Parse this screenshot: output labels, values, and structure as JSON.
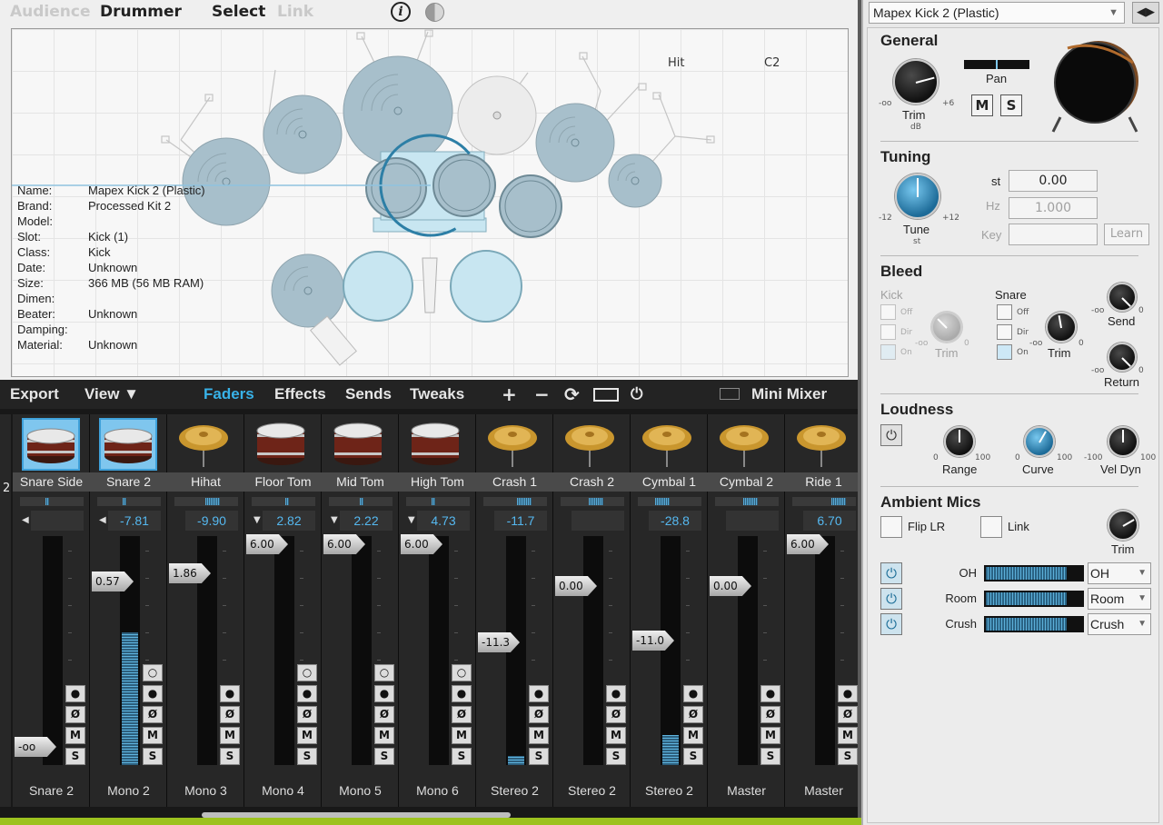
{
  "top_nav": {
    "audience": "Audience",
    "drummer": "Drummer",
    "select": "Select",
    "link": "Link"
  },
  "info_icon": "i",
  "hit_labels": {
    "hit": "Hit",
    "note": "C2"
  },
  "instrument_info": [
    {
      "k": "Name:",
      "v": "Mapex Kick 2 (Plastic)"
    },
    {
      "k": "Brand:",
      "v": "Processed Kit 2"
    },
    {
      "k": "Model:",
      "v": ""
    },
    {
      "k": "Slot:",
      "v": "Kick (1)"
    },
    {
      "k": "Class:",
      "v": "Kick"
    },
    {
      "k": "Date:",
      "v": "Unknown"
    },
    {
      "k": "Size:",
      "v": "366 MB (56 MB RAM)"
    },
    {
      "k": "Dimen:",
      "v": ""
    },
    {
      "k": "Beater:",
      "v": "Unknown"
    },
    {
      "k": "Damping:",
      "v": ""
    },
    {
      "k": "Material:",
      "v": "Unknown"
    }
  ],
  "toolbar": {
    "export": "Export",
    "view": "View ▼",
    "faders": "Faders",
    "effects": "Effects",
    "sends": "Sends",
    "tweaks": "Tweaks",
    "add": "+",
    "remove": "−",
    "refresh": "⟳",
    "power": "⏻",
    "mini_mixer": "Mini Mixer"
  },
  "left_edge": {
    "name": "2",
    "glyph": "◂"
  },
  "channels": [
    {
      "name": "Snare Side",
      "out": "Snare 2",
      "vol": "",
      "cap": "-oo",
      "cap_y": 0.97,
      "meter": 0,
      "pan": 0.45,
      "type": "snare",
      "selected": true,
      "arrow": "◀",
      "pwr": false
    },
    {
      "name": "Snare 2",
      "out": "Mono 2",
      "vol": "-7.81",
      "cap": "0.57",
      "cap_y": 0.18,
      "meter": 0.58,
      "pan": 0.45,
      "type": "snare",
      "selected": true,
      "arrow": "◀",
      "pwr": true
    },
    {
      "name": "Hihat",
      "out": "Mono 3",
      "vol": "-9.90",
      "cap": "1.86",
      "cap_y": 0.14,
      "meter": 0,
      "pan": 0.55,
      "type": "cymbal",
      "selected": false,
      "arrow": "",
      "pwr": false
    },
    {
      "name": "Floor Tom",
      "out": "Mono 4",
      "vol": "2.82",
      "cap": "6.00",
      "cap_y": 0.0,
      "meter": 0,
      "pan": 0.6,
      "type": "tom",
      "selected": false,
      "arrow": "▼",
      "pwr": true
    },
    {
      "name": "Mid Tom",
      "out": "Mono 5",
      "vol": "2.22",
      "cap": "6.00",
      "cap_y": 0.0,
      "meter": 0,
      "pan": 0.55,
      "type": "tom",
      "selected": false,
      "arrow": "▼",
      "pwr": true
    },
    {
      "name": "High Tom",
      "out": "Mono 6",
      "vol": "4.73",
      "cap": "6.00",
      "cap_y": 0.0,
      "meter": 0,
      "pan": 0.45,
      "type": "tom",
      "selected": false,
      "arrow": "▼",
      "pwr": true
    },
    {
      "name": "Crash 1",
      "out": "Stereo 2",
      "vol": "-11.7",
      "cap": "-11.3",
      "cap_y": 0.47,
      "meter": 0.04,
      "pan": 0.6,
      "type": "cymbal",
      "selected": false,
      "arrow": "",
      "pwr": false
    },
    {
      "name": "Crash 2",
      "out": "Stereo 2",
      "vol": "",
      "cap": "0.00",
      "cap_y": 0.2,
      "meter": 0,
      "pan": 0.5,
      "type": "cymbal",
      "selected": false,
      "arrow": "",
      "pwr": false
    },
    {
      "name": "Cymbal 1",
      "out": "Stereo 2",
      "vol": "-28.8",
      "cap": "-11.0",
      "cap_y": 0.46,
      "meter": 0.13,
      "pan": 0.3,
      "type": "cymbal",
      "selected": false,
      "arrow": "",
      "pwr": false
    },
    {
      "name": "Cymbal 2",
      "out": "Master",
      "vol": "",
      "cap": "0.00",
      "cap_y": 0.2,
      "meter": 0,
      "pan": 0.5,
      "type": "cymbal",
      "selected": false,
      "arrow": "",
      "pwr": false
    },
    {
      "name": "Ride 1",
      "out": "Master",
      "vol": "6.70",
      "cap": "6.00",
      "cap_y": 0.0,
      "meter": 0,
      "pan": 0.7,
      "type": "cymbal",
      "selected": false,
      "arrow": "",
      "pwr": false
    }
  ],
  "channel_buttons": {
    "pwr": "○",
    "rec": "●",
    "phase": "Ø",
    "mute": "M",
    "solo": "S"
  },
  "right": {
    "kit": "Mapex Kick 2 (Plastic)",
    "kit_nav": "◀▶",
    "general": {
      "title": "General",
      "trim": "Trim",
      "trim_unit": "dB",
      "min": "-oo",
      "max": "+6",
      "pan": "Pan",
      "pan_value": 0.5,
      "mute": "M",
      "solo": "S"
    },
    "tuning": {
      "title": "Tuning",
      "tune": "Tune",
      "tune_unit": "st",
      "min": "-12",
      "max": "+12",
      "st_label": "st",
      "st": "0.00",
      "hz_label": "Hz",
      "hz": "1.000",
      "key_label": "Key",
      "key": "",
      "learn": "Learn"
    },
    "bleed": {
      "title": "Bleed",
      "kick": "Kick",
      "snare": "Snare",
      "off": "Off",
      "dir": "Dir",
      "on": "On",
      "trim": "Trim",
      "send": "Send",
      "return": "Return",
      "min": "-oo",
      "max": "0"
    },
    "loudness": {
      "title": "Loudness",
      "range": "Range",
      "curve": "Curve",
      "vel_dyn": "Vel Dyn",
      "r_min": "0",
      "r_max": "100",
      "c_min": "0",
      "c_max": "100",
      "v_min": "-100",
      "v_max": "100"
    },
    "ambient": {
      "title": "Ambient Mics",
      "flip": "Flip LR",
      "link": "Link",
      "trim": "Trim",
      "mics": [
        {
          "label": "OH",
          "level": 0.84,
          "sel": "OH"
        },
        {
          "label": "Room",
          "level": 0.84,
          "sel": "Room"
        },
        {
          "label": "Crush",
          "level": 0.84,
          "sel": "Crush"
        }
      ]
    }
  },
  "colors": {
    "accent": "#38b2e8",
    "drum_fill": "#a7bfcb",
    "drum_light": "#c8e6f1"
  }
}
